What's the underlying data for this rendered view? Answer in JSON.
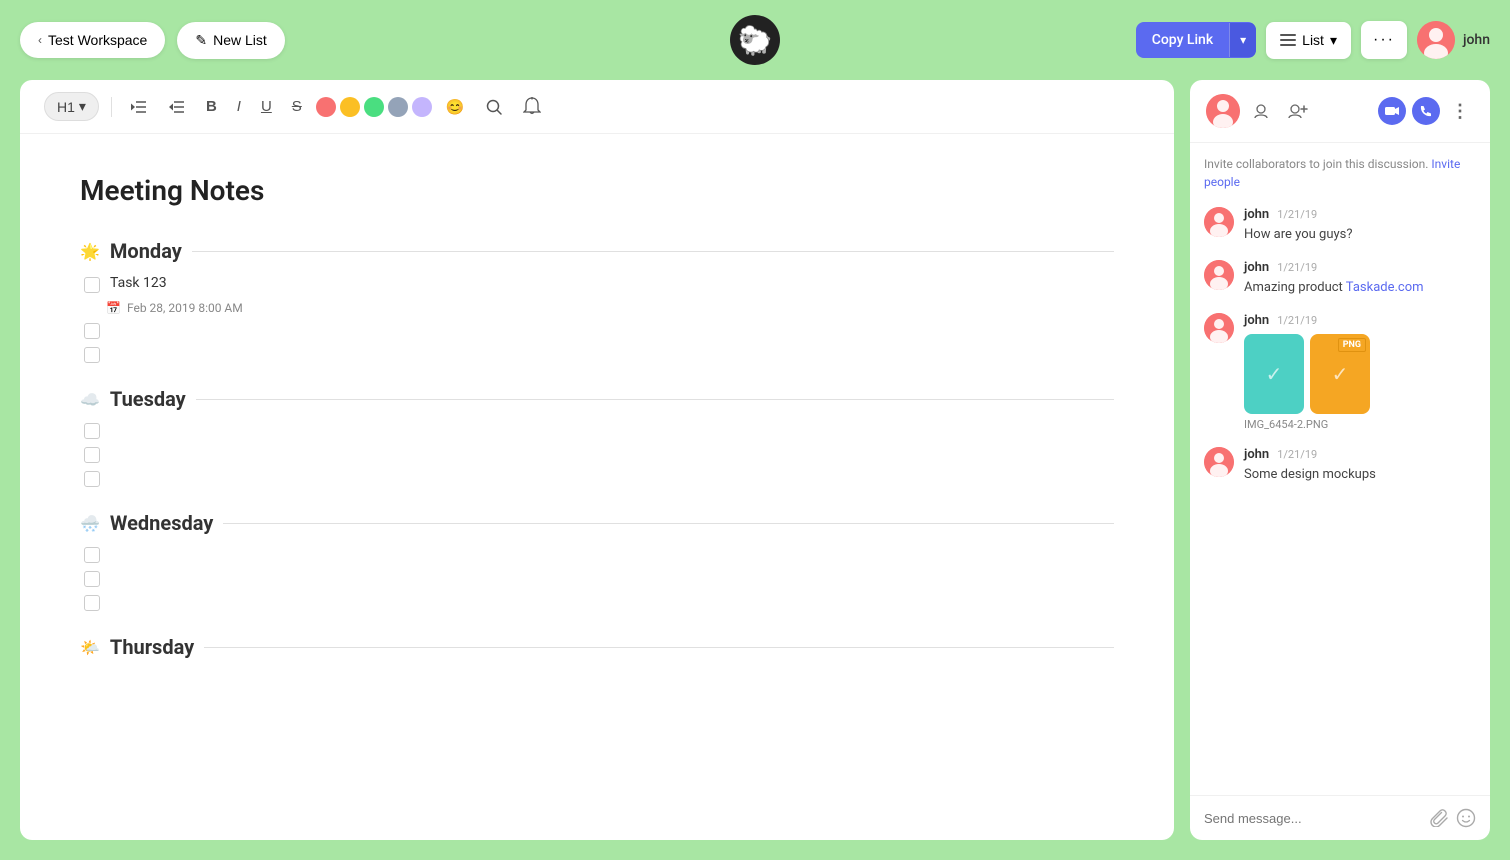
{
  "topbar": {
    "back_label": "Test Workspace",
    "new_list_label": "New List",
    "copy_link_label": "Copy Link",
    "list_label": "List",
    "more_label": "···",
    "user_name": "john"
  },
  "editor": {
    "toolbar": {
      "heading_label": "H1",
      "heading_chevron": "▾",
      "bold_label": "B",
      "italic_label": "I",
      "underline_label": "U",
      "strikethrough_label": "S",
      "colors": [
        "#f87171",
        "#fbbf24",
        "#4ade80",
        "#94a3b8",
        "#c4b5fd"
      ],
      "emoji_label": "😊",
      "search_label": "🔍",
      "bell_label": "🔔"
    },
    "document": {
      "title": "Meeting Notes",
      "sections": [
        {
          "id": "monday",
          "icon": "🌟",
          "label": "Monday",
          "tasks": [
            {
              "id": "task1",
              "text": "Task 123",
              "date": "Feb 28, 2019 8:00 AM",
              "checked": false
            },
            {
              "id": "task2",
              "text": "",
              "checked": false
            },
            {
              "id": "task3",
              "text": "",
              "checked": false
            }
          ]
        },
        {
          "id": "tuesday",
          "icon": "☁️",
          "label": "Tuesday",
          "tasks": [
            {
              "id": "task4",
              "text": "",
              "checked": false
            },
            {
              "id": "task5",
              "text": "",
              "checked": false
            },
            {
              "id": "task6",
              "text": "",
              "checked": false
            }
          ]
        },
        {
          "id": "wednesday",
          "icon": "🌨️",
          "label": "Wednesday",
          "tasks": [
            {
              "id": "task7",
              "text": "",
              "checked": false
            },
            {
              "id": "task8",
              "text": "",
              "checked": false
            },
            {
              "id": "task9",
              "text": "",
              "checked": false
            }
          ]
        },
        {
          "id": "thursday",
          "icon": "🌤️",
          "label": "Thursday",
          "tasks": []
        }
      ]
    }
  },
  "chat": {
    "invite_text": "Invite collaborators to join this discussion.",
    "invite_link_text": "Invite people",
    "messages": [
      {
        "id": "msg1",
        "user": "john",
        "time": "1/21/19",
        "text": "How are you guys?",
        "type": "text"
      },
      {
        "id": "msg2",
        "user": "john",
        "time": "1/21/19",
        "text": "Amazing product ",
        "link_text": "Taskade.com",
        "link_url": "#",
        "type": "link"
      },
      {
        "id": "msg3",
        "user": "john",
        "time": "1/21/19",
        "text": "",
        "type": "image",
        "image_label": "IMG_6454-2.PNG"
      },
      {
        "id": "msg4",
        "user": "john",
        "time": "1/21/19",
        "text": "Some design mockups",
        "type": "text"
      }
    ],
    "input_placeholder": "Send message...",
    "header_icons": {
      "add_person": "👤+",
      "video_call": "📹",
      "phone_call": "📞",
      "more": "⋮"
    }
  },
  "icons": {
    "back_chevron": "‹",
    "new_list_icon": "✎",
    "copy_chevron": "▾",
    "list_view_icon": "≡",
    "list_chevron": "▾",
    "calendar_icon": "📅",
    "attach_icon": "📎",
    "emoji_icon": "🙂"
  }
}
